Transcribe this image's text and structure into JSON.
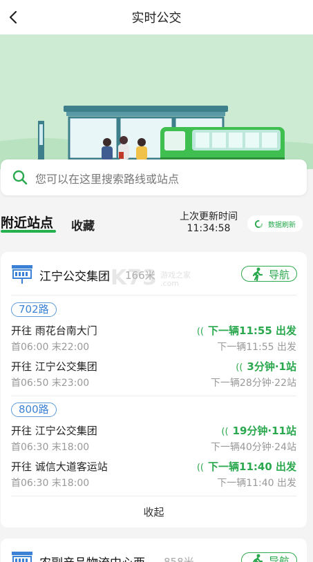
{
  "header": {
    "title": "实时公交",
    "back_icon": "chevron-left-icon"
  },
  "search": {
    "placeholder": "您可以在这里搜索路线或站点",
    "icon": "search-icon"
  },
  "tabs": {
    "nearby": "附近站点",
    "favorites": "收藏",
    "update_label": "上次更新时间",
    "update_time": "11:34:58",
    "refresh_label": "数据刷新"
  },
  "colors": {
    "accent_green": "#2aa84d",
    "route_blue": "#3b82d6",
    "hero_bg": "#cdebd3"
  },
  "stops": [
    {
      "name": "江宁公交集团",
      "distance": "166米",
      "nav_label": "导航",
      "routes": [
        {
          "name": "702路",
          "directions": [
            {
              "to": "开往 雨花台南大门",
              "times": "首06:00 末22:00",
              "live": "下一辆11:55 出发",
              "next": "下一辆11:55 出发"
            },
            {
              "to": "开往 江宁公交集团",
              "times": "首06:50 末23:00",
              "live": "3分钟·1站",
              "next": "下一辆28分钟·22站"
            }
          ]
        },
        {
          "name": "800路",
          "directions": [
            {
              "to": "开往 江宁公交集团",
              "times": "首06:30 末18:00",
              "live": "19分钟·11站",
              "next": "下一辆40分钟·24站"
            },
            {
              "to": "开往 诚信大道客运站",
              "times": "首06:30 末18:00",
              "live": "下一辆11:40 出发",
              "next": "下一辆11:40 出发"
            }
          ]
        }
      ],
      "collapse_label": "收起"
    },
    {
      "name": "农副产品物流中心西",
      "distance": "858米",
      "nav_label": "导航"
    }
  ],
  "watermark": {
    "big": "K73",
    "line1": "游戏之家",
    "line2": ".com"
  }
}
